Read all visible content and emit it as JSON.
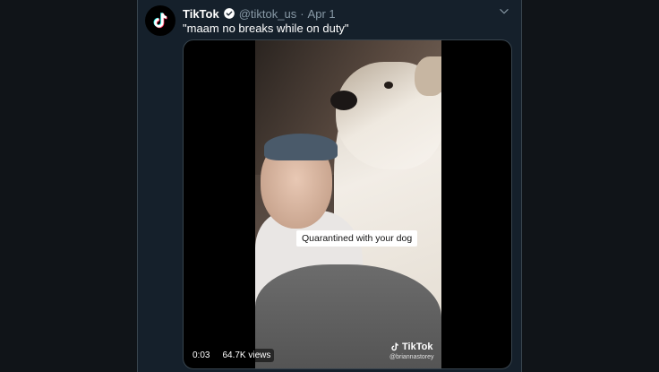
{
  "tweet": {
    "display_name": "TikTok",
    "verified_icon": "verified-badge-icon",
    "handle": "@tiktok_us",
    "separator": "·",
    "date": "Apr 1",
    "text": "\"maam no breaks while on duty\"",
    "menu_icon": "chevron-down-icon"
  },
  "video": {
    "caption": "Quarantined with your dog",
    "duration": "0:03",
    "views": "64.7K views",
    "watermark_brand": "TikTok",
    "watermark_user": "@briannastorey"
  },
  "colors": {
    "background": "#15202b",
    "text": "#ffffff",
    "secondary_text": "#8899a6",
    "verified": "#1da1f2",
    "border": "#38444d"
  }
}
